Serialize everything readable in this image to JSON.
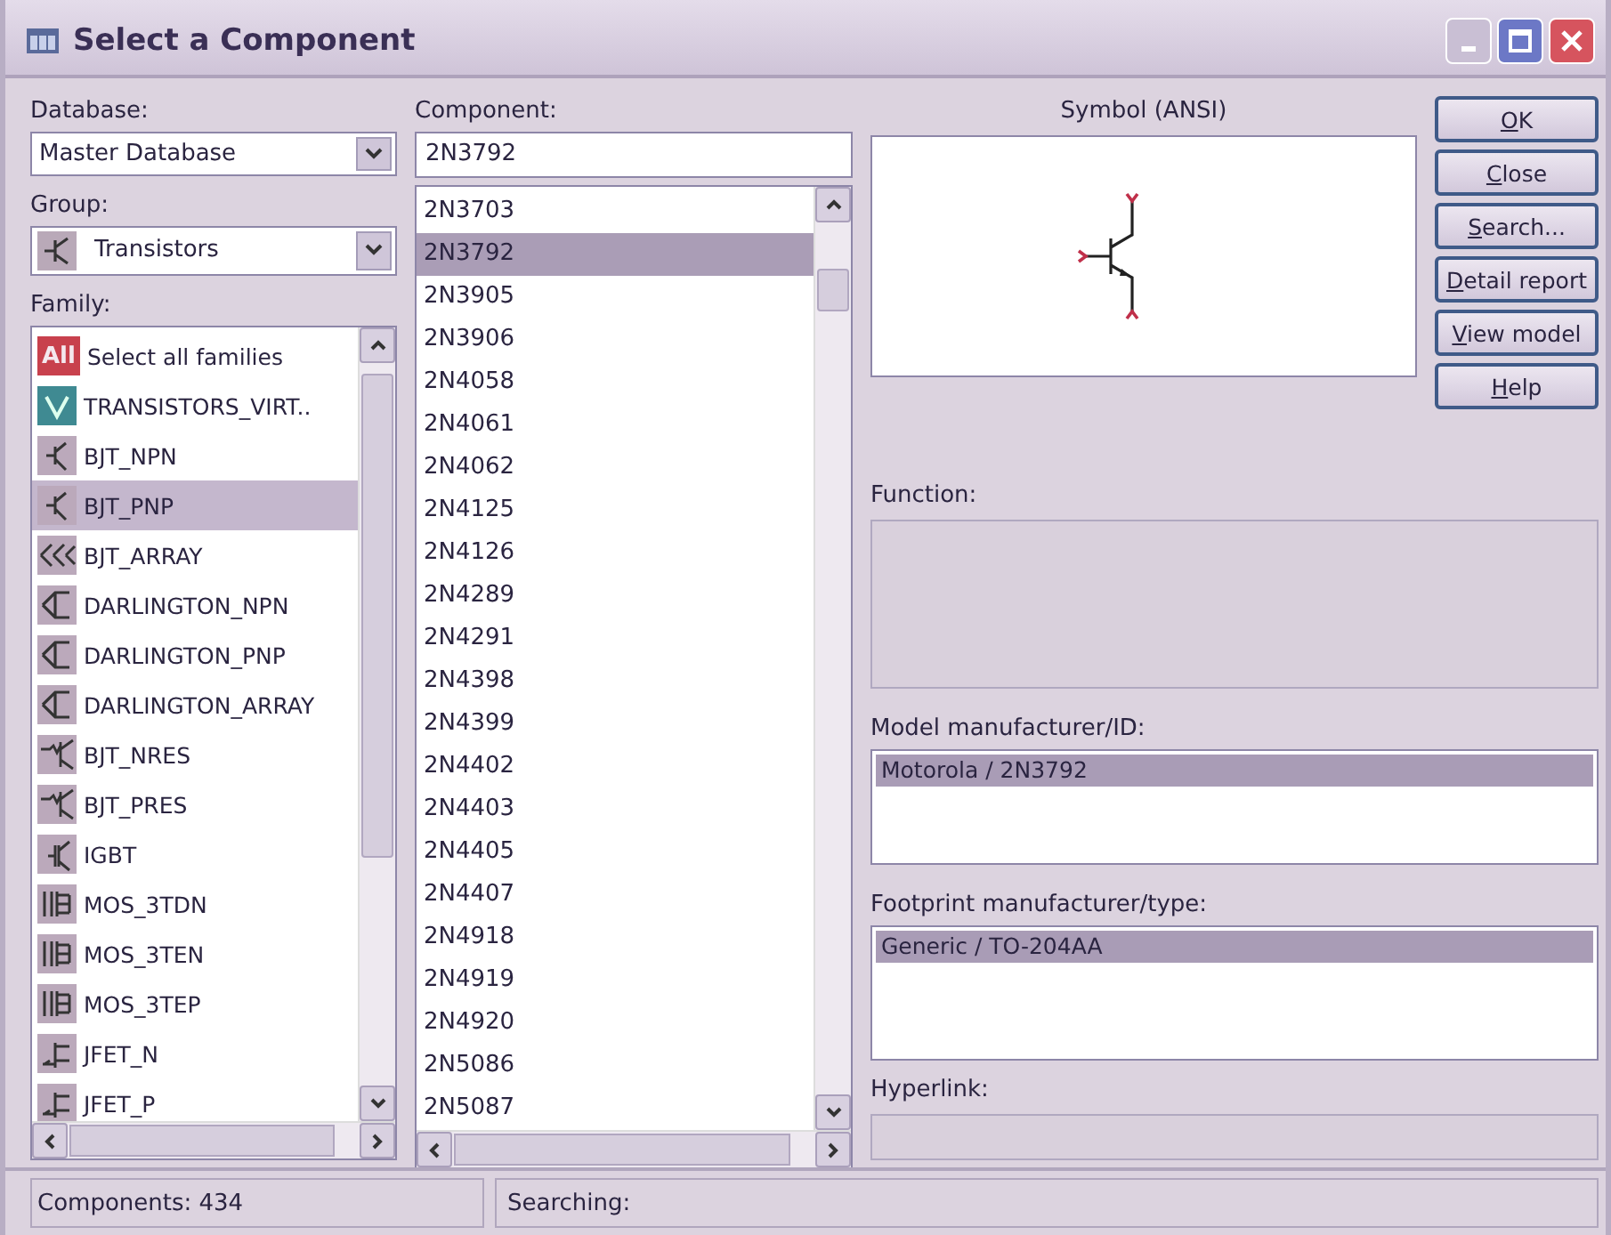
{
  "window": {
    "title": "Select a Component"
  },
  "database": {
    "label": "Database:",
    "value": "Master Database"
  },
  "group": {
    "label": "Group:",
    "value": "Transistors"
  },
  "family": {
    "label": "Family:",
    "items": [
      {
        "kind": "all",
        "icon_text": "All",
        "label": "Select all families",
        "selected": false
      },
      {
        "kind": "virtual",
        "label": "TRANSISTORS_VIRT..",
        "selected": false
      },
      {
        "kind": "bjt",
        "label": "BJT_NPN",
        "selected": false
      },
      {
        "kind": "bjt",
        "label": "BJT_PNP",
        "selected": true
      },
      {
        "kind": "array",
        "label": "BJT_ARRAY",
        "selected": false
      },
      {
        "kind": "darlington",
        "label": "DARLINGTON_NPN",
        "selected": false
      },
      {
        "kind": "darlington",
        "label": "DARLINGTON_PNP",
        "selected": false
      },
      {
        "kind": "darlington",
        "label": "DARLINGTON_ARRAY",
        "selected": false
      },
      {
        "kind": "res",
        "label": "BJT_NRES",
        "selected": false
      },
      {
        "kind": "res",
        "label": "BJT_PRES",
        "selected": false
      },
      {
        "kind": "igbt",
        "label": "IGBT",
        "selected": false
      },
      {
        "kind": "mos",
        "label": "MOS_3TDN",
        "selected": false
      },
      {
        "kind": "mos",
        "label": "MOS_3TEN",
        "selected": false
      },
      {
        "kind": "mos",
        "label": "MOS_3TEP",
        "selected": false
      },
      {
        "kind": "jfet",
        "label": "JFET_N",
        "selected": false
      },
      {
        "kind": "jfet",
        "label": "JFET_P",
        "selected": false
      }
    ]
  },
  "component": {
    "label": "Component:",
    "value": "2N3792",
    "items": [
      {
        "label": "2N3703",
        "selected": false
      },
      {
        "label": "2N3792",
        "selected": true
      },
      {
        "label": "2N3905",
        "selected": false
      },
      {
        "label": "2N3906",
        "selected": false
      },
      {
        "label": "2N4058",
        "selected": false
      },
      {
        "label": "2N4061",
        "selected": false
      },
      {
        "label": "2N4062",
        "selected": false
      },
      {
        "label": "2N4125",
        "selected": false
      },
      {
        "label": "2N4126",
        "selected": false
      },
      {
        "label": "2N4289",
        "selected": false
      },
      {
        "label": "2N4291",
        "selected": false
      },
      {
        "label": "2N4398",
        "selected": false
      },
      {
        "label": "2N4399",
        "selected": false
      },
      {
        "label": "2N4402",
        "selected": false
      },
      {
        "label": "2N4403",
        "selected": false
      },
      {
        "label": "2N4405",
        "selected": false
      },
      {
        "label": "2N4407",
        "selected": false
      },
      {
        "label": "2N4918",
        "selected": false
      },
      {
        "label": "2N4919",
        "selected": false
      },
      {
        "label": "2N4920",
        "selected": false
      },
      {
        "label": "2N5086",
        "selected": false
      },
      {
        "label": "2N5087",
        "selected": false
      }
    ]
  },
  "symbol": {
    "label": "Symbol (ANSI)"
  },
  "buttons": [
    {
      "label": "OK"
    },
    {
      "label": "Close"
    },
    {
      "label": "Search..."
    },
    {
      "label": "Detail report"
    },
    {
      "label": "View model"
    },
    {
      "label": "Help"
    }
  ],
  "function": {
    "label": "Function:"
  },
  "model": {
    "label": "Model manufacturer/ID:",
    "items": [
      {
        "label": "Motorola / 2N3792",
        "selected": true
      }
    ]
  },
  "footprint": {
    "label": "Footprint manufacturer/type:",
    "items": [
      {
        "label": "Generic / TO-204AA",
        "selected": true
      }
    ]
  },
  "hyperlink": {
    "label": "Hyperlink:"
  },
  "status_bar": {
    "components": "Components: 434",
    "searching": "Searching:"
  }
}
